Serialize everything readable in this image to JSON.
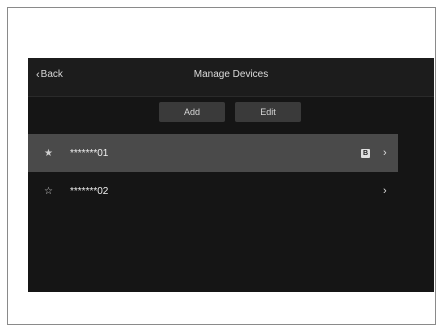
{
  "header": {
    "back_label": "Back",
    "title": "Manage Devices"
  },
  "actions": {
    "add_label": "Add",
    "edit_label": "Edit"
  },
  "devices": [
    {
      "name": "*******01",
      "favorite": true,
      "badge": "B",
      "selected": true
    },
    {
      "name": "*******02",
      "favorite": false,
      "badge": "",
      "selected": false
    }
  ],
  "icons": {
    "back": "chevron-left-icon",
    "favorite_filled": "star-filled-icon",
    "favorite_outline": "star-outline-icon",
    "row_arrow": "chevron-right-icon"
  },
  "colors": {
    "screen_bg": "#151515",
    "header_bg": "#1c1c1c",
    "button_bg": "#3a3a3a",
    "selected_row_bg": "#4a4a4a"
  }
}
